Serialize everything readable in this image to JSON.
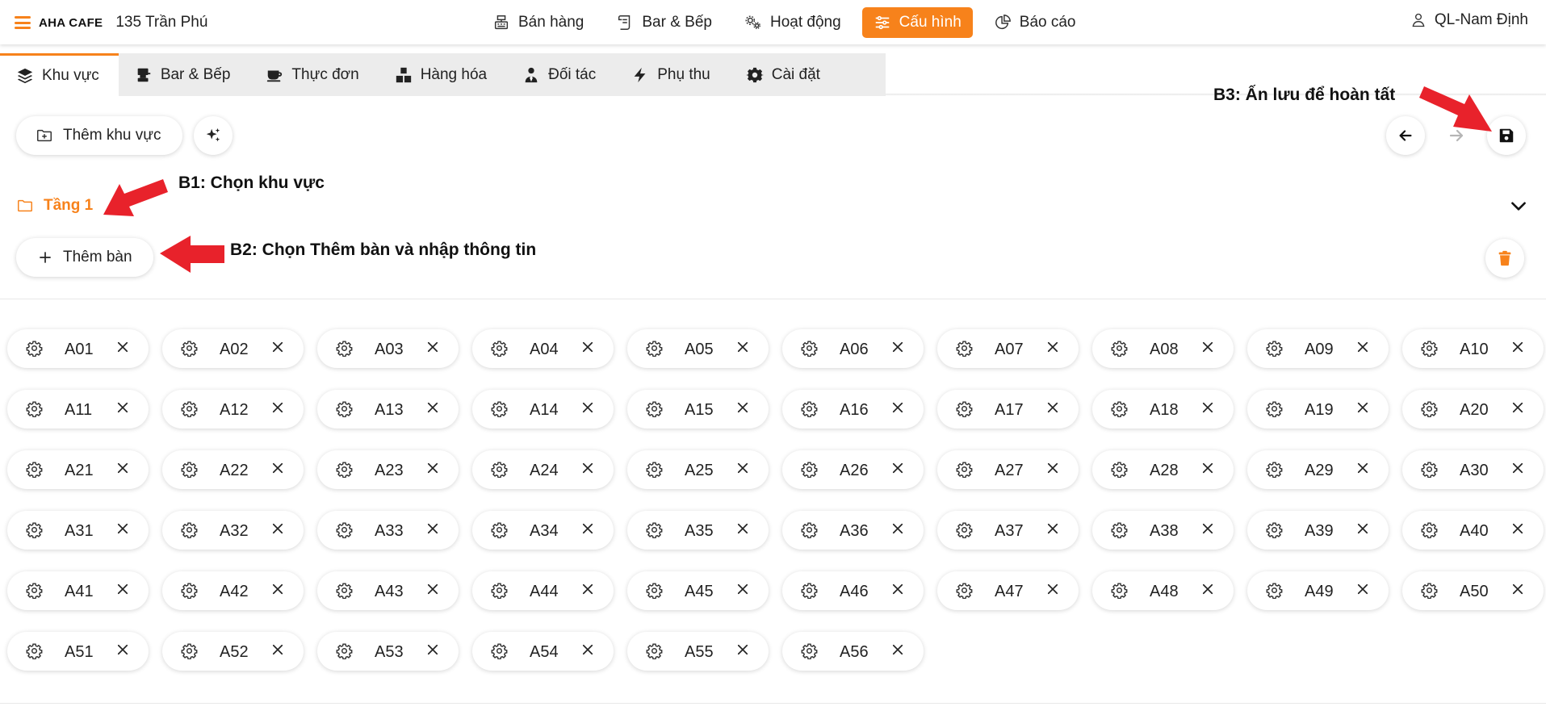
{
  "header": {
    "brand": "AHA CAFE",
    "branch": "135 Trần Phú",
    "nav": [
      {
        "label": "Bán hàng",
        "icon": "cash-register-icon",
        "active": false
      },
      {
        "label": "Bar & Bếp",
        "icon": "scroll-icon",
        "active": false
      },
      {
        "label": "Hoạt động",
        "icon": "gears-icon",
        "active": false
      },
      {
        "label": "Cấu hình",
        "icon": "sliders-icon",
        "active": true
      },
      {
        "label": "Báo cáo",
        "icon": "pie-chart-icon",
        "active": false
      }
    ],
    "user": "QL-Nam Định"
  },
  "subtabs": [
    {
      "label": "Khu vực",
      "icon": "layers-icon",
      "active": true
    },
    {
      "label": "Bar & Bếp",
      "icon": "counter-icon",
      "active": false
    },
    {
      "label": "Thực đơn",
      "icon": "coffee-cup-icon",
      "active": false
    },
    {
      "label": "Hàng hóa",
      "icon": "boxes-icon",
      "active": false
    },
    {
      "label": "Đối tác",
      "icon": "person-tie-icon",
      "active": false
    },
    {
      "label": "Phụ thu",
      "icon": "bolt-icon",
      "active": false
    },
    {
      "label": "Cài đặt",
      "icon": "gear-icon",
      "active": false
    }
  ],
  "toolbar": {
    "add_area_label": "Thêm khu vực",
    "add_table_label": "Thêm bàn"
  },
  "area": {
    "name": "Tầng 1"
  },
  "annotations": {
    "b1": "B1: Chọn khu vực",
    "b2": "B2: Chọn Thêm bàn và nhập thông tin",
    "b3": "B3: Ấn lưu để hoàn tất"
  },
  "colors": {
    "accent": "#f7821b",
    "arrow": "#e8222b"
  },
  "tables": [
    "A01",
    "A02",
    "A03",
    "A04",
    "A05",
    "A06",
    "A07",
    "A08",
    "A09",
    "A10",
    "A11",
    "A12",
    "A13",
    "A14",
    "A15",
    "A16",
    "A17",
    "A18",
    "A19",
    "A20",
    "A21",
    "A22",
    "A23",
    "A24",
    "A25",
    "A26",
    "A27",
    "A28",
    "A29",
    "A30",
    "A31",
    "A32",
    "A33",
    "A34",
    "A35",
    "A36",
    "A37",
    "A38",
    "A39",
    "A40",
    "A41",
    "A42",
    "A43",
    "A44",
    "A45",
    "A46",
    "A47",
    "A48",
    "A49",
    "A50",
    "A51",
    "A52",
    "A53",
    "A54",
    "A55",
    "A56"
  ]
}
